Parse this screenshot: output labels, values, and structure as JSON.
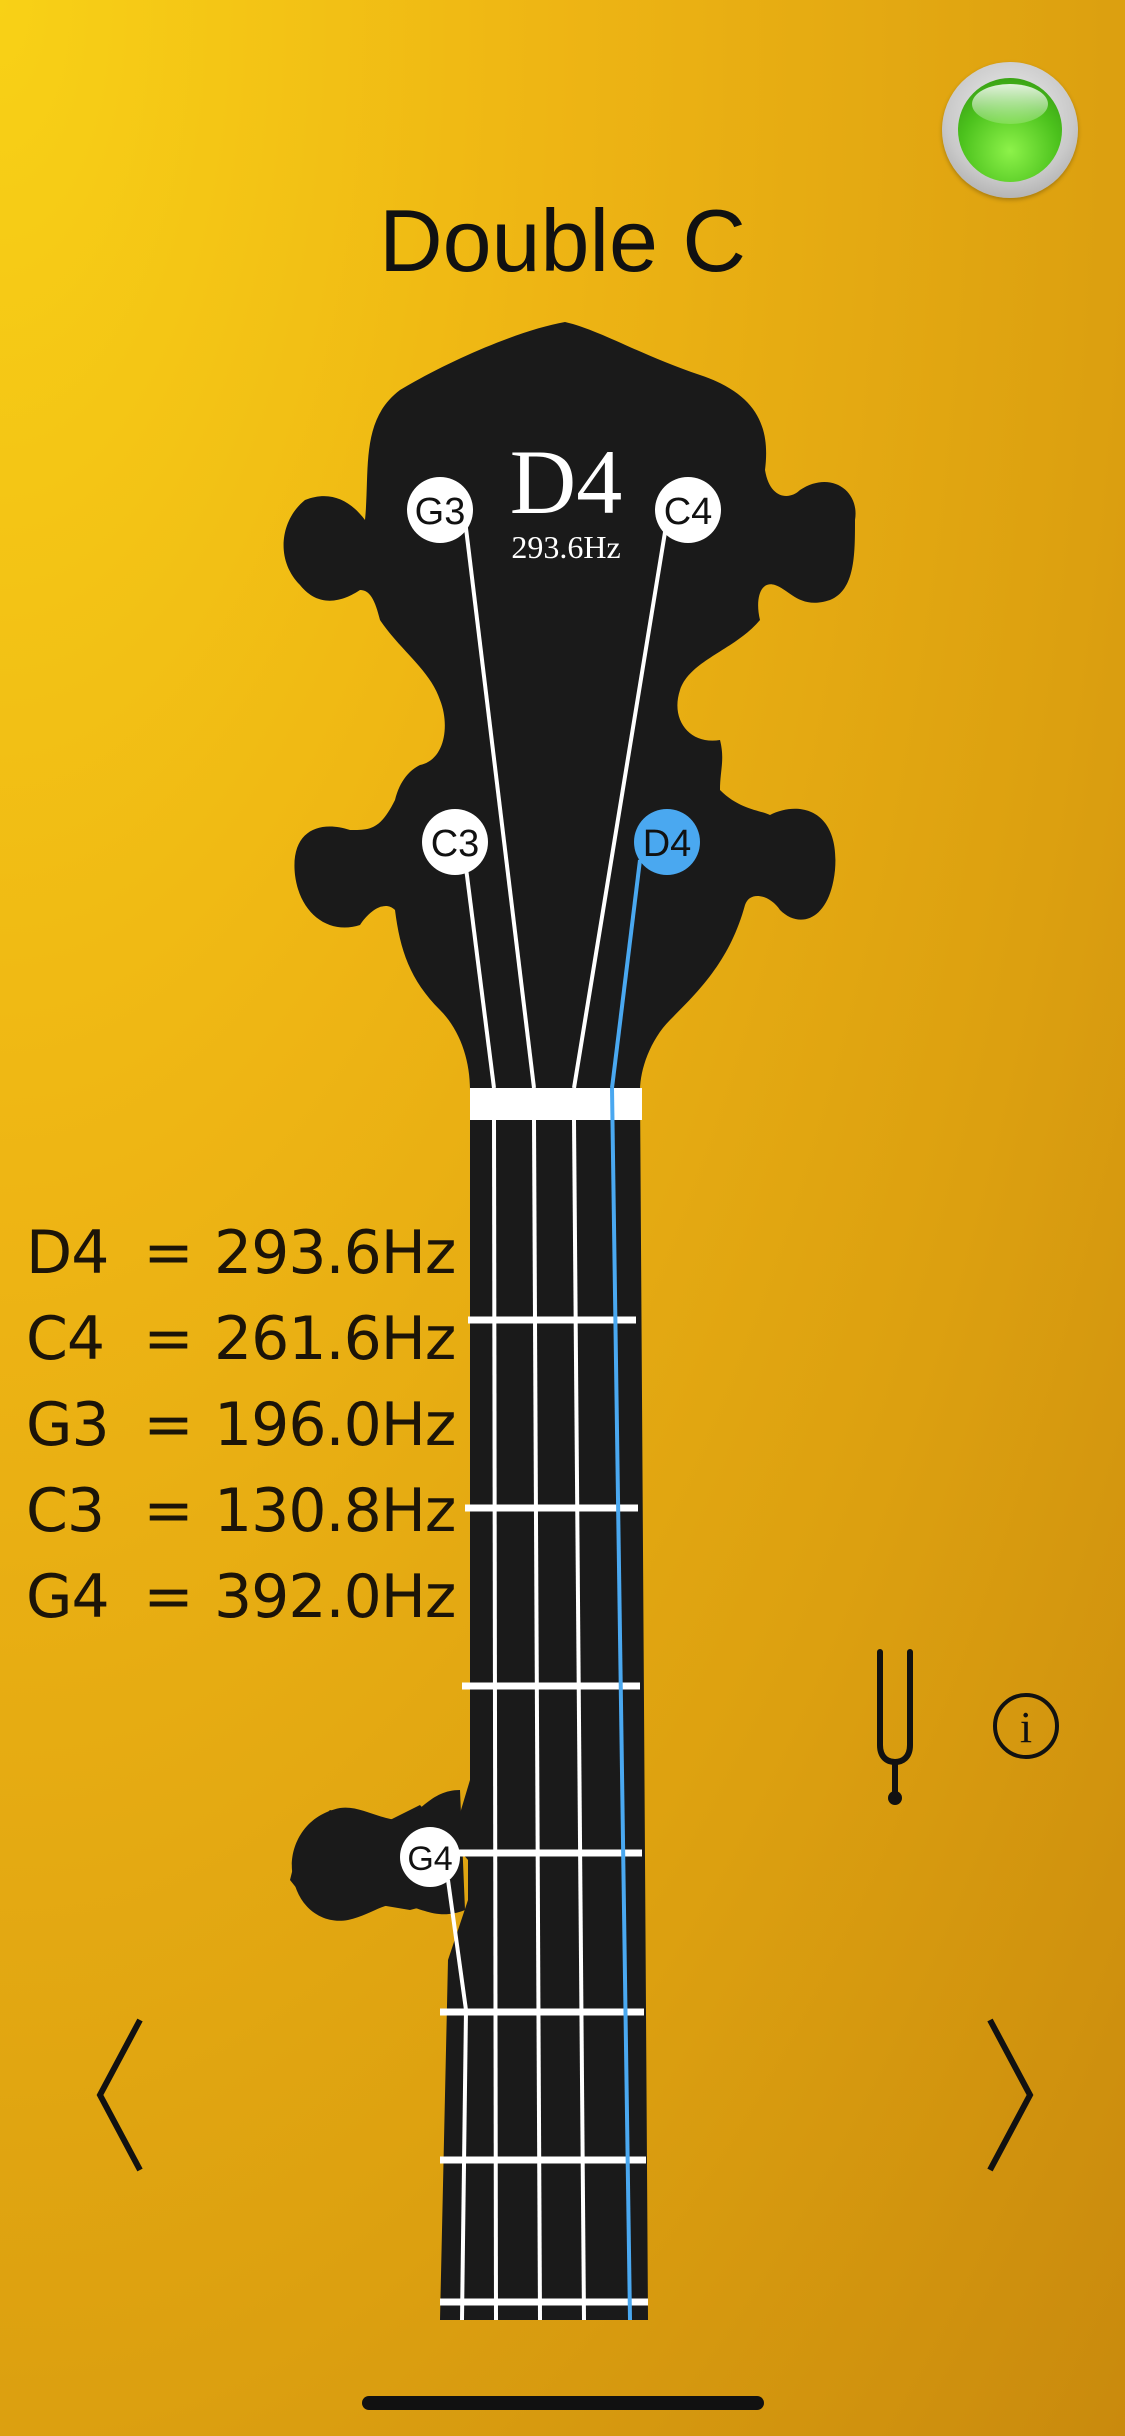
{
  "status": {
    "indicator": "green-led-icon",
    "indicator_color": "#4cc21d"
  },
  "tuning": {
    "name": "Double C"
  },
  "selected": {
    "note": "D4",
    "freq": "293.6Hz"
  },
  "pegs": [
    {
      "label": "G3",
      "selected": false
    },
    {
      "label": "C4",
      "selected": false
    },
    {
      "label": "C3",
      "selected": false
    },
    {
      "label": "D4",
      "selected": true
    },
    {
      "label": "G4",
      "selected": false
    }
  ],
  "frequencies": [
    {
      "note": "D4",
      "eq": "=",
      "freq": "293.6Hz"
    },
    {
      "note": "C4",
      "eq": "=",
      "freq": "261.6Hz"
    },
    {
      "note": "G3",
      "eq": "=",
      "freq": "196.0Hz"
    },
    {
      "note": "C3",
      "eq": "=",
      "freq": "130.8Hz"
    },
    {
      "note": "G4",
      "eq": "=",
      "freq": "392.0Hz"
    }
  ],
  "controls": {
    "tuning_fork": "tuning-fork-icon",
    "info": "info-icon",
    "prev": "chevron-left-icon",
    "next": "chevron-right-icon"
  },
  "colors": {
    "accent": "#4aa8f0",
    "headstock": "#1a1a1a",
    "string": "#ffffff"
  }
}
